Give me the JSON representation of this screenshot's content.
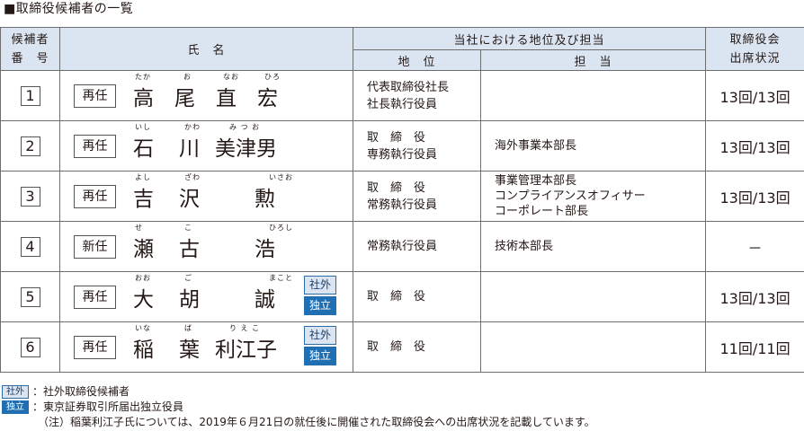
{
  "title": "■取締役候補者の一覧",
  "headers": {
    "num": [
      "候補者",
      "番　号"
    ],
    "name": "氏　名",
    "role_group": "当社における地位及び担当",
    "position": "地　位",
    "duty": "担　当",
    "attendance": [
      "取締役会",
      "出席状況"
    ]
  },
  "badges": {
    "outside": "社外",
    "independent": "独立"
  },
  "candidates": [
    {
      "num": "1",
      "status": "再任",
      "kanji": [
        "高",
        "尾",
        "直",
        "宏"
      ],
      "ruby": [
        "たか",
        "お",
        "なお",
        "ひろ"
      ],
      "position": [
        "代表取締役社長",
        "社長執行役員"
      ],
      "duty": [],
      "attendance": "13回/13回"
    },
    {
      "num": "2",
      "status": "再任",
      "kanji": [
        "石",
        "川",
        "美津男"
      ],
      "ruby": [
        "いし",
        "かわ",
        "み つ お"
      ],
      "position": [
        "取　締　役",
        "専務執行役員"
      ],
      "duty": [
        "海外事業本部長"
      ],
      "attendance": "13回/13回"
    },
    {
      "num": "3",
      "status": "再任",
      "kanji": [
        "吉",
        "沢",
        "勲"
      ],
      "ruby": [
        "よし",
        "ざわ",
        "いさお"
      ],
      "position": [
        "取　締　役",
        "常務執行役員"
      ],
      "duty": [
        "事業管理本部長",
        "コンプライアンスオフィサー",
        "コーポレート部長"
      ],
      "attendance": "13回/13回"
    },
    {
      "num": "4",
      "status": "新任",
      "kanji": [
        "瀬",
        "古",
        "浩"
      ],
      "ruby": [
        "せ",
        "こ",
        "ひろし"
      ],
      "position": [
        "常務執行役員"
      ],
      "duty": [
        "技術本部長"
      ],
      "attendance": "－"
    },
    {
      "num": "5",
      "status": "再任",
      "kanji": [
        "大",
        "胡",
        "誠"
      ],
      "ruby": [
        "おお",
        "ご",
        "まこと"
      ],
      "position": [
        "取　締　役"
      ],
      "duty": [],
      "attendance": "13回/13回"
    },
    {
      "num": "6",
      "status": "再任",
      "kanji": [
        "稲",
        "葉",
        "利江子"
      ],
      "ruby": [
        "いな",
        "ば",
        "り え こ"
      ],
      "position": [
        "取　締　役"
      ],
      "duty": [],
      "attendance": "11回/11回"
    }
  ],
  "notes": {
    "outside_desc": "：社外取締役候補者",
    "independent_desc": "：東京証券取引所届出独立役員",
    "remark": "（注）稲葉利江子氏については、2019年６月21日の就任後に開催された取締役会への出席状況を記載しています。"
  },
  "colors": {
    "header_bg": "#dbe5f1",
    "badge_independent": "#1f6fb2",
    "border": "#6e6e6e"
  }
}
